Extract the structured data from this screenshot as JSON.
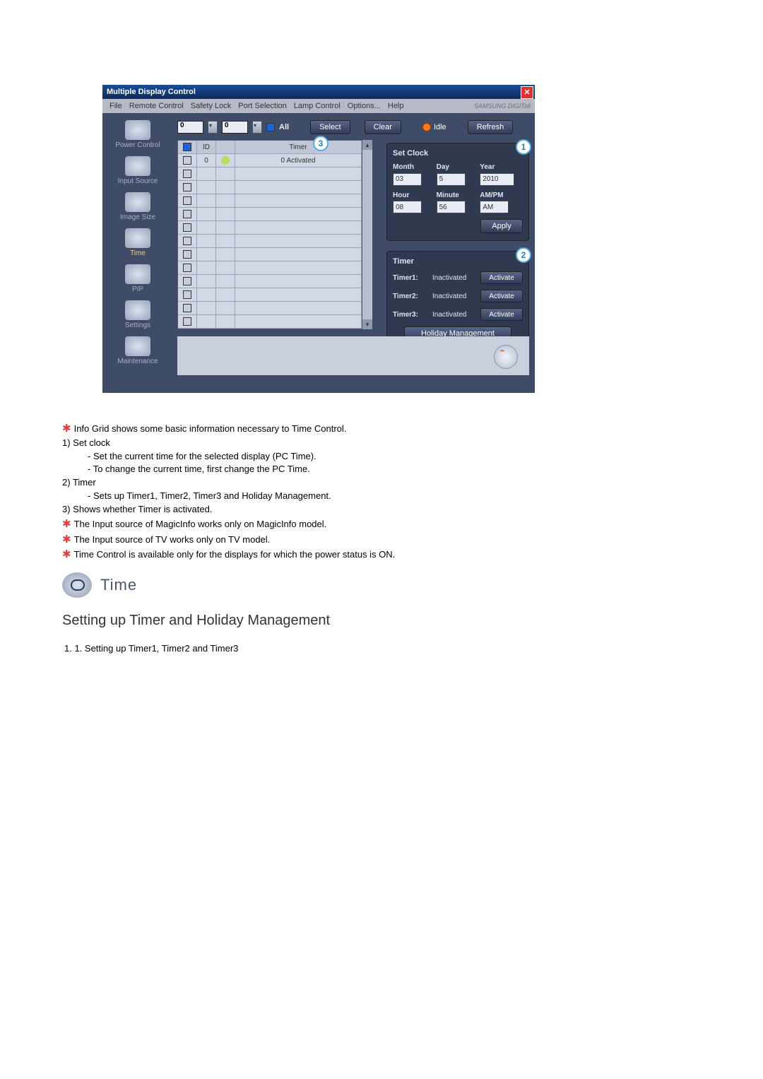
{
  "window": {
    "title": "Multiple Display Control",
    "menubar": [
      "File",
      "Remote Control",
      "Safety Lock",
      "Port Selection",
      "Lamp Control",
      "Options...",
      "Help"
    ],
    "brand": "SAMSUNG DIGITall"
  },
  "sidebar": {
    "items": [
      {
        "label": "Power Control"
      },
      {
        "label": "Input Source"
      },
      {
        "label": "Image Size"
      },
      {
        "label": "Time"
      },
      {
        "label": "PIP"
      },
      {
        "label": "Settings"
      },
      {
        "label": "Maintenance"
      }
    ]
  },
  "toolbar": {
    "spin1": "0",
    "spin2": "0",
    "all": "All",
    "select": "Select",
    "clear": "Clear",
    "idle": "Idle",
    "refresh": "Refresh"
  },
  "grid": {
    "headers": {
      "c2": "ID",
      "c4": "Timer"
    },
    "first_row_id": "0",
    "first_row_text": "0 Activated"
  },
  "set_clock": {
    "title": "Set Clock",
    "month_lbl": "Month",
    "day_lbl": "Day",
    "year_lbl": "Year",
    "hour_lbl": "Hour",
    "min_lbl": "Minute",
    "ampm_lbl": "AM/PM",
    "month": "03",
    "day": "5",
    "year": "2010",
    "hour": "08",
    "min": "56",
    "ampm": "AM",
    "apply": "Apply"
  },
  "timer": {
    "title": "Timer",
    "rows": [
      {
        "name": "Timer1:",
        "status": "Inactivated",
        "btn": "Activate"
      },
      {
        "name": "Timer2:",
        "status": "Inactivated",
        "btn": "Activate"
      },
      {
        "name": "Timer3:",
        "status": "Inactivated",
        "btn": "Activate"
      }
    ],
    "holiday": "Holiday Management"
  },
  "markers": {
    "one": "1",
    "two": "2",
    "three": "3"
  },
  "article": {
    "l1": "Info Grid shows some basic information necessary to Time Control.",
    "l2": "Set clock",
    "l2a": "Set the current time for the selected display (PC Time).",
    "l2b": "To change the current time, first change the PC Time.",
    "l3": "Timer",
    "l3a": "Sets up Timer1, Timer2, Timer3 and Holiday Management.",
    "l4": "Shows whether Timer is activated.",
    "n1": "The Input source of MagicInfo works only on MagicInfo model.",
    "n2": "The Input source of TV works only on TV model.",
    "n3": "Time Control is available only for the displays for which the power status is ON.",
    "h_time": "Time",
    "h_sub": "Setting up Timer and Holiday Management",
    "last": "1. 1. Setting up Timer1, Timer2 and Timer3"
  }
}
